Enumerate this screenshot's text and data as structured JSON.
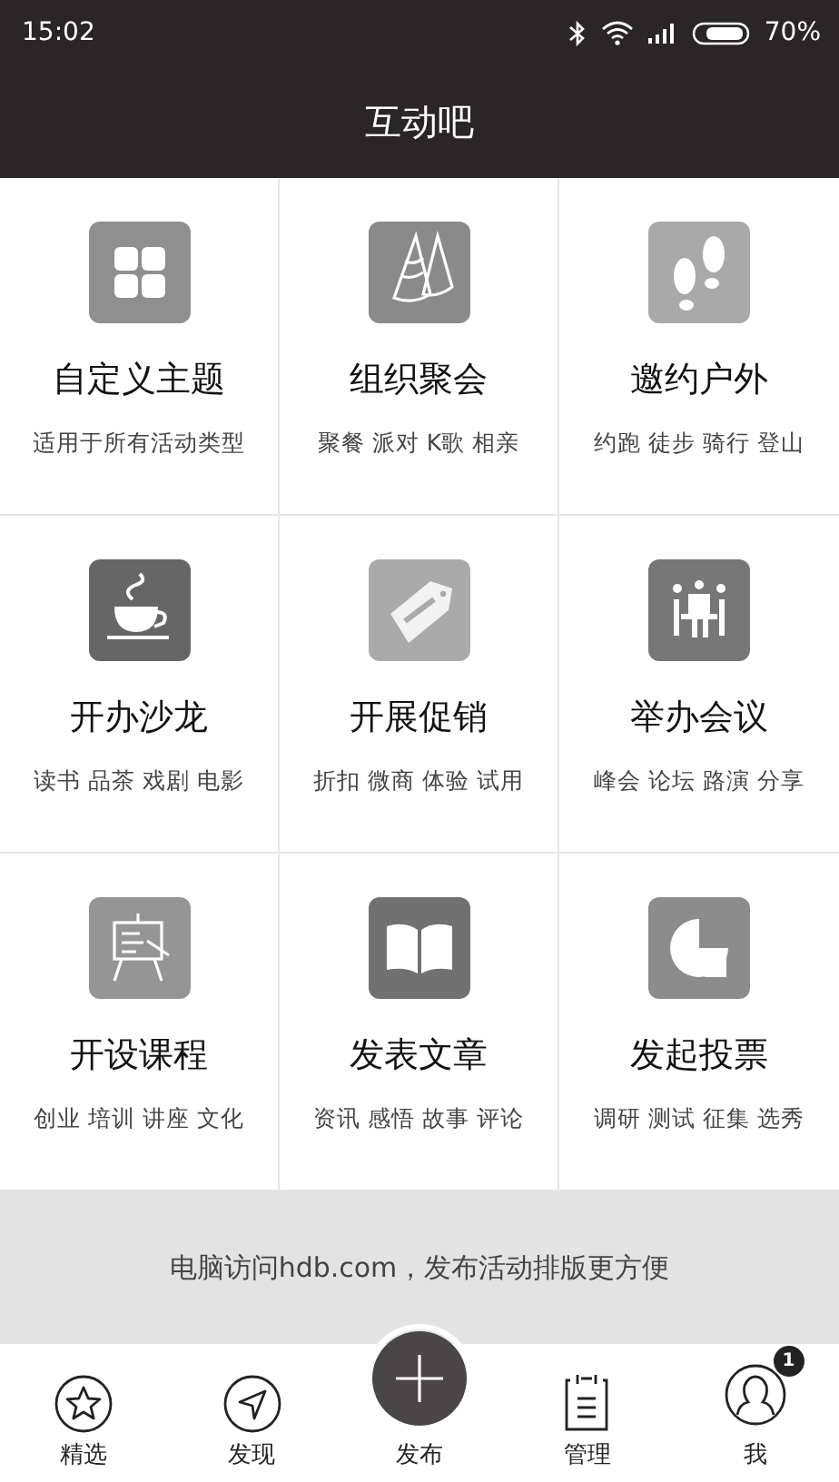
{
  "status_bar": {
    "time": "15:02",
    "battery": "70%"
  },
  "title": "互动吧",
  "tiles": [
    {
      "title": "自定义主题",
      "subtitle": "适用于所有活动类型",
      "color": "#8f8f8f"
    },
    {
      "title": "组织聚会",
      "subtitle": "聚餐 派对 K歌 相亲",
      "color": "#8a8a8a"
    },
    {
      "title": "邀约户外",
      "subtitle": "约跑 徒步 骑行 登山",
      "color": "#a9a9a9"
    },
    {
      "title": "开办沙龙",
      "subtitle": "读书 品茶 戏剧 电影",
      "color": "#666666"
    },
    {
      "title": "开展促销",
      "subtitle": "折扣 微商 体验 试用",
      "color": "#aaaaaa"
    },
    {
      "title": "举办会议",
      "subtitle": "峰会 论坛 路演 分享",
      "color": "#777777"
    },
    {
      "title": "开设课程",
      "subtitle": "创业 培训 讲座 文化",
      "color": "#959595"
    },
    {
      "title": "发表文章",
      "subtitle": "资讯 感悟 故事 评论",
      "color": "#717171"
    },
    {
      "title": "发起投票",
      "subtitle": "调研 测试 征集 选秀",
      "color": "#8c8c8c"
    }
  ],
  "banner": "电脑访问hdb.com，发布活动排版更方便",
  "tab_bar": [
    {
      "label": "精选"
    },
    {
      "label": "发现"
    },
    {
      "label": "发布"
    },
    {
      "label": "管理"
    },
    {
      "label": "我",
      "badge": "1"
    }
  ]
}
